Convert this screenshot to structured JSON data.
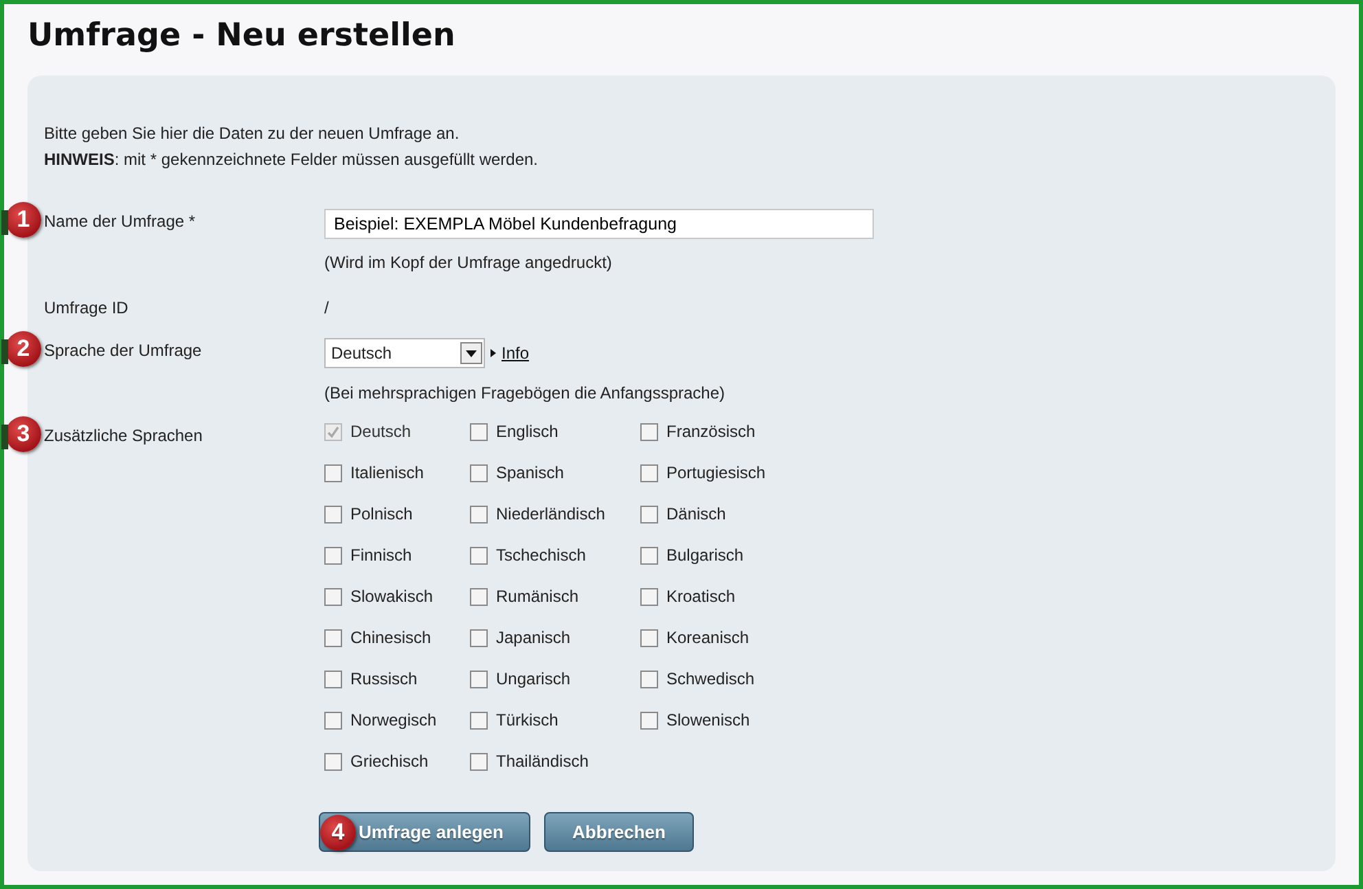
{
  "title": "Umfrage - Neu erstellen",
  "intro": {
    "text": "Bitte geben Sie hier die Daten zu der neuen Umfrage an.",
    "note": "**HINWEIS**: mit * gekennzeichnete Felder müssen ausgefüllt werden."
  },
  "fields": [
    {
      "kind": "text",
      "marker": "1",
      "label": "Name der Umfrage *",
      "value": "Beispiel: EXEMPLA Möbel Kundenbefragung",
      "hint": "(Wird im Kopf der Umfrage angedruckt)"
    },
    {
      "kind": "static",
      "label": "Umfrage ID",
      "value": "/"
    },
    {
      "kind": "select",
      "marker": "2",
      "label": "Sprache der Umfrage",
      "value": "Deutsch",
      "link": "Info",
      "hint": "(Bei mehrsprachigen Fragebögen die Anfangssprache)"
    },
    {
      "kind": "checkboxes",
      "marker": "3",
      "label": "Zusätzliche Sprachen",
      "options": [
        {
          "label": "Deutsch",
          "checked": true,
          "disabled": true
        },
        {
          "label": "Englisch",
          "checked": false,
          "disabled": false
        },
        {
          "label": "Französisch",
          "checked": false,
          "disabled": false
        },
        {
          "label": "Italienisch",
          "checked": false,
          "disabled": false
        },
        {
          "label": "Spanisch",
          "checked": false,
          "disabled": false
        },
        {
          "label": "Portugiesisch",
          "checked": false,
          "disabled": false
        },
        {
          "label": "Polnisch",
          "checked": false,
          "disabled": false
        },
        {
          "label": "Niederländisch",
          "checked": false,
          "disabled": false
        },
        {
          "label": "Dänisch",
          "checked": false,
          "disabled": false
        },
        {
          "label": "Finnisch",
          "checked": false,
          "disabled": false
        },
        {
          "label": "Tschechisch",
          "checked": false,
          "disabled": false
        },
        {
          "label": "Bulgarisch",
          "checked": false,
          "disabled": false
        },
        {
          "label": "Slowakisch",
          "checked": false,
          "disabled": false
        },
        {
          "label": "Rumänisch",
          "checked": false,
          "disabled": false
        },
        {
          "label": "Kroatisch",
          "checked": false,
          "disabled": false
        },
        {
          "label": "Chinesisch",
          "checked": false,
          "disabled": false
        },
        {
          "label": "Japanisch",
          "checked": false,
          "disabled": false
        },
        {
          "label": "Koreanisch",
          "checked": false,
          "disabled": false
        },
        {
          "label": "Russisch",
          "checked": false,
          "disabled": false
        },
        {
          "label": "Ungarisch",
          "checked": false,
          "disabled": false
        },
        {
          "label": "Schwedisch",
          "checked": false,
          "disabled": false
        },
        {
          "label": "Norwegisch",
          "checked": false,
          "disabled": false
        },
        {
          "label": "Türkisch",
          "checked": false,
          "disabled": false
        },
        {
          "label": "Slowenisch",
          "checked": false,
          "disabled": false
        },
        {
          "label": "Griechisch",
          "checked": false,
          "disabled": false
        },
        {
          "label": "Thailändisch",
          "checked": false,
          "disabled": false
        }
      ]
    }
  ],
  "buttons": [
    {
      "label": "Umfrage anlegen",
      "marker": "4"
    },
    {
      "label": "Abbrechen"
    }
  ]
}
